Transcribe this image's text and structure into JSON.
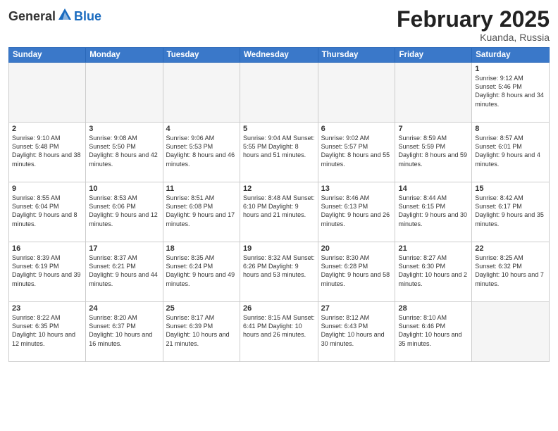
{
  "logo": {
    "general": "General",
    "blue": "Blue"
  },
  "title": "February 2025",
  "location": "Kuanda, Russia",
  "days_of_week": [
    "Sunday",
    "Monday",
    "Tuesday",
    "Wednesday",
    "Thursday",
    "Friday",
    "Saturday"
  ],
  "weeks": [
    [
      {
        "num": "",
        "info": ""
      },
      {
        "num": "",
        "info": ""
      },
      {
        "num": "",
        "info": ""
      },
      {
        "num": "",
        "info": ""
      },
      {
        "num": "",
        "info": ""
      },
      {
        "num": "",
        "info": ""
      },
      {
        "num": "1",
        "info": "Sunrise: 9:12 AM\nSunset: 5:46 PM\nDaylight: 8 hours\nand 34 minutes."
      }
    ],
    [
      {
        "num": "2",
        "info": "Sunrise: 9:10 AM\nSunset: 5:48 PM\nDaylight: 8 hours\nand 38 minutes."
      },
      {
        "num": "3",
        "info": "Sunrise: 9:08 AM\nSunset: 5:50 PM\nDaylight: 8 hours\nand 42 minutes."
      },
      {
        "num": "4",
        "info": "Sunrise: 9:06 AM\nSunset: 5:53 PM\nDaylight: 8 hours\nand 46 minutes."
      },
      {
        "num": "5",
        "info": "Sunrise: 9:04 AM\nSunset: 5:55 PM\nDaylight: 8 hours\nand 51 minutes."
      },
      {
        "num": "6",
        "info": "Sunrise: 9:02 AM\nSunset: 5:57 PM\nDaylight: 8 hours\nand 55 minutes."
      },
      {
        "num": "7",
        "info": "Sunrise: 8:59 AM\nSunset: 5:59 PM\nDaylight: 8 hours\nand 59 minutes."
      },
      {
        "num": "8",
        "info": "Sunrise: 8:57 AM\nSunset: 6:01 PM\nDaylight: 9 hours\nand 4 minutes."
      }
    ],
    [
      {
        "num": "9",
        "info": "Sunrise: 8:55 AM\nSunset: 6:04 PM\nDaylight: 9 hours\nand 8 minutes."
      },
      {
        "num": "10",
        "info": "Sunrise: 8:53 AM\nSunset: 6:06 PM\nDaylight: 9 hours\nand 12 minutes."
      },
      {
        "num": "11",
        "info": "Sunrise: 8:51 AM\nSunset: 6:08 PM\nDaylight: 9 hours\nand 17 minutes."
      },
      {
        "num": "12",
        "info": "Sunrise: 8:48 AM\nSunset: 6:10 PM\nDaylight: 9 hours\nand 21 minutes."
      },
      {
        "num": "13",
        "info": "Sunrise: 8:46 AM\nSunset: 6:13 PM\nDaylight: 9 hours\nand 26 minutes."
      },
      {
        "num": "14",
        "info": "Sunrise: 8:44 AM\nSunset: 6:15 PM\nDaylight: 9 hours\nand 30 minutes."
      },
      {
        "num": "15",
        "info": "Sunrise: 8:42 AM\nSunset: 6:17 PM\nDaylight: 9 hours\nand 35 minutes."
      }
    ],
    [
      {
        "num": "16",
        "info": "Sunrise: 8:39 AM\nSunset: 6:19 PM\nDaylight: 9 hours\nand 39 minutes."
      },
      {
        "num": "17",
        "info": "Sunrise: 8:37 AM\nSunset: 6:21 PM\nDaylight: 9 hours\nand 44 minutes."
      },
      {
        "num": "18",
        "info": "Sunrise: 8:35 AM\nSunset: 6:24 PM\nDaylight: 9 hours\nand 49 minutes."
      },
      {
        "num": "19",
        "info": "Sunrise: 8:32 AM\nSunset: 6:26 PM\nDaylight: 9 hours\nand 53 minutes."
      },
      {
        "num": "20",
        "info": "Sunrise: 8:30 AM\nSunset: 6:28 PM\nDaylight: 9 hours\nand 58 minutes."
      },
      {
        "num": "21",
        "info": "Sunrise: 8:27 AM\nSunset: 6:30 PM\nDaylight: 10 hours\nand 2 minutes."
      },
      {
        "num": "22",
        "info": "Sunrise: 8:25 AM\nSunset: 6:32 PM\nDaylight: 10 hours\nand 7 minutes."
      }
    ],
    [
      {
        "num": "23",
        "info": "Sunrise: 8:22 AM\nSunset: 6:35 PM\nDaylight: 10 hours\nand 12 minutes."
      },
      {
        "num": "24",
        "info": "Sunrise: 8:20 AM\nSunset: 6:37 PM\nDaylight: 10 hours\nand 16 minutes."
      },
      {
        "num": "25",
        "info": "Sunrise: 8:17 AM\nSunset: 6:39 PM\nDaylight: 10 hours\nand 21 minutes."
      },
      {
        "num": "26",
        "info": "Sunrise: 8:15 AM\nSunset: 6:41 PM\nDaylight: 10 hours\nand 26 minutes."
      },
      {
        "num": "27",
        "info": "Sunrise: 8:12 AM\nSunset: 6:43 PM\nDaylight: 10 hours\nand 30 minutes."
      },
      {
        "num": "28",
        "info": "Sunrise: 8:10 AM\nSunset: 6:46 PM\nDaylight: 10 hours\nand 35 minutes."
      },
      {
        "num": "",
        "info": ""
      }
    ]
  ]
}
